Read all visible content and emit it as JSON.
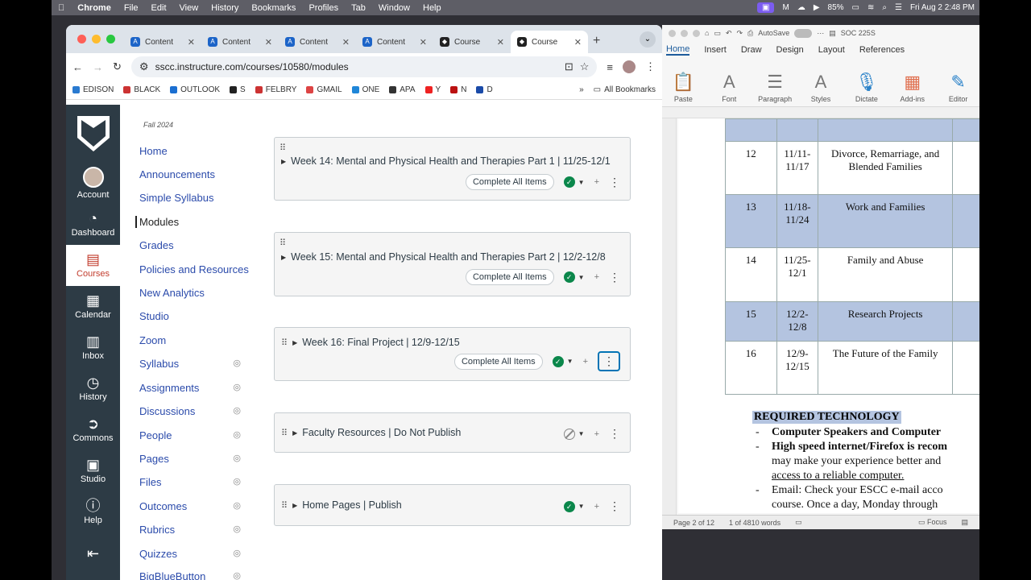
{
  "menubar": {
    "apple": "",
    "app": "Chrome",
    "items": [
      "File",
      "Edit",
      "View",
      "History",
      "Bookmarks",
      "Profiles",
      "Tab",
      "Window",
      "Help"
    ],
    "battery": "85%",
    "datetime": "Fri Aug 2  2:48 PM"
  },
  "browser": {
    "tabs": [
      {
        "label": "Content",
        "active": false
      },
      {
        "label": "Content",
        "active": false
      },
      {
        "label": "Content",
        "active": false
      },
      {
        "label": "Content",
        "active": false
      },
      {
        "label": "Course",
        "active": false
      },
      {
        "label": "Course",
        "active": true
      }
    ],
    "url": "sscc.instructure.com/courses/10580/modules",
    "bookmarks": [
      "EDISON",
      "BLACK",
      "OUTLOOK",
      "S",
      "FELBRY",
      "GMAIL",
      "ONE",
      "APA",
      "Y",
      "N",
      "D"
    ],
    "bookmarks_more": "»",
    "all_bookmarks": "All Bookmarks"
  },
  "global_nav": [
    {
      "label": "Account",
      "icon": "avatar"
    },
    {
      "label": "Dashboard",
      "icon": "dashboard-icon"
    },
    {
      "label": "Courses",
      "icon": "courses-icon"
    },
    {
      "label": "Calendar",
      "icon": "calendar-icon"
    },
    {
      "label": "Inbox",
      "icon": "inbox-icon"
    },
    {
      "label": "History",
      "icon": "history-icon"
    },
    {
      "label": "Commons",
      "icon": "commons-icon"
    },
    {
      "label": "Studio",
      "icon": "studio-icon"
    },
    {
      "label": "Help",
      "icon": "help-icon"
    }
  ],
  "course_nav": {
    "term": "Fall 2024",
    "items": [
      "Home",
      "Announcements",
      "Simple Syllabus",
      "Modules",
      "Grades",
      "Policies and Resources",
      "New Analytics",
      "Studio",
      "Zoom",
      "Syllabus",
      "Assignments",
      "Discussions",
      "People",
      "Pages",
      "Files",
      "Outcomes",
      "Rubrics",
      "Quizzes",
      "BigBlueButton"
    ],
    "active": "Modules"
  },
  "modules": [
    {
      "title": "Week 14: Mental and Physical Health and Therapies Part 1 | 11/25-12/1",
      "complete_label": "Complete All Items",
      "published": true
    },
    {
      "title": "Week 15: Mental and Physical Health and Therapies Part 2 | 12/2-12/8",
      "complete_label": "Complete All Items",
      "published": true
    },
    {
      "title": "Week 16: Final Project | 12/9-12/15",
      "complete_label": "Complete All Items",
      "published": true
    },
    {
      "title": "Faculty Resources | Do Not Publish",
      "complete_label": "",
      "published": false
    },
    {
      "title": "Home Pages | Publish",
      "complete_label": "",
      "published": true
    }
  ],
  "word": {
    "autosave": "AutoSave",
    "doc_title": "SOC 225S",
    "tabs": [
      "Home",
      "Insert",
      "Draw",
      "Design",
      "Layout",
      "References"
    ],
    "ribbon": [
      "Paste",
      "Font",
      "Paragraph",
      "Styles",
      "Dictate",
      "Add-ins",
      "Editor"
    ],
    "schedule": [
      {
        "week": "12",
        "dates": "11/11-\n11/17",
        "topic": "Divorce, Remarriage, and\nBlended Families"
      },
      {
        "week": "13",
        "dates": "11/18-\n11/24",
        "topic": "Work and Families"
      },
      {
        "week": "14",
        "dates": "11/25-\n12/1",
        "topic": "Family and Abuse"
      },
      {
        "week": "15",
        "dates": "12/2-\n12/8",
        "topic": "Research Projects"
      },
      {
        "week": "16",
        "dates": "12/9-\n12/15",
        "topic": "The Future of the Family"
      }
    ],
    "heading": "REQUIRED TECHNOLOGY",
    "bullets": [
      "Computer Speakers and Computer",
      "High speed internet/Firefox is recom",
      "may make your experience better and",
      "access to a reliable computer.",
      "Email: Check your ESCC e-mail acco",
      "course.  Once a day, Monday through"
    ],
    "status": {
      "page": "Page 2 of 12",
      "words": "1 of 4810 words",
      "focus": "Focus"
    }
  }
}
